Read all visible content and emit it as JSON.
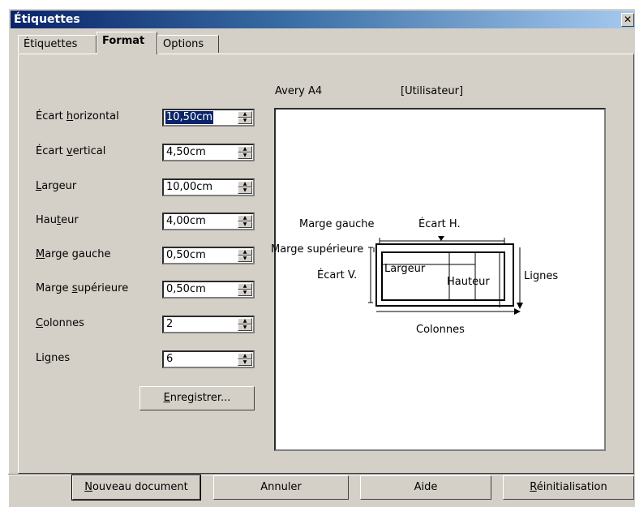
{
  "window": {
    "title": "Étiquettes",
    "close_glyph": "✕"
  },
  "tabs": [
    {
      "label": "Étiquettes"
    },
    {
      "label": "Format"
    },
    {
      "label": "Options"
    }
  ],
  "fields": [
    {
      "label_pre": "Écart ",
      "label_u": "h",
      "label_post": "orizontal",
      "value": "10,50cm"
    },
    {
      "label_pre": "Écart ",
      "label_u": "v",
      "label_post": "ertical",
      "value": "4,50cm"
    },
    {
      "label_pre": "",
      "label_u": "L",
      "label_post": "argeur",
      "value": "10,00cm"
    },
    {
      "label_pre": "Hau",
      "label_u": "t",
      "label_post": "eur",
      "value": "4,00cm"
    },
    {
      "label_pre": "",
      "label_u": "M",
      "label_post": "arge gauche",
      "value": "0,50cm"
    },
    {
      "label_pre": "Marge ",
      "label_u": "s",
      "label_post": "upérieure",
      "value": "0,50cm"
    },
    {
      "label_pre": "",
      "label_u": "C",
      "label_post": "olonnes",
      "value": "2"
    },
    {
      "label_pre": "Li",
      "label_u": "g",
      "label_post": "nes",
      "value": "6"
    }
  ],
  "save_button": {
    "u": "E",
    "rest": "nregistrer..."
  },
  "preview": {
    "brand": "Avery A4",
    "type": "[Utilisateur]",
    "labels": {
      "marge_gauche": "Marge gauche",
      "ecart_h": "Écart H.",
      "marge_sup": "Marge supérieure",
      "ecart_v": "Écart V.",
      "largeur": "Largeur",
      "hauteur": "Hauteur",
      "lignes": "Lignes",
      "colonnes": "Colonnes"
    }
  },
  "bottom_buttons": {
    "new_doc": {
      "u": "N",
      "rest": "ouveau document"
    },
    "cancel": "Annuler",
    "help": "Aide",
    "reset": {
      "u": "R",
      "rest": "éinitialisation"
    }
  }
}
